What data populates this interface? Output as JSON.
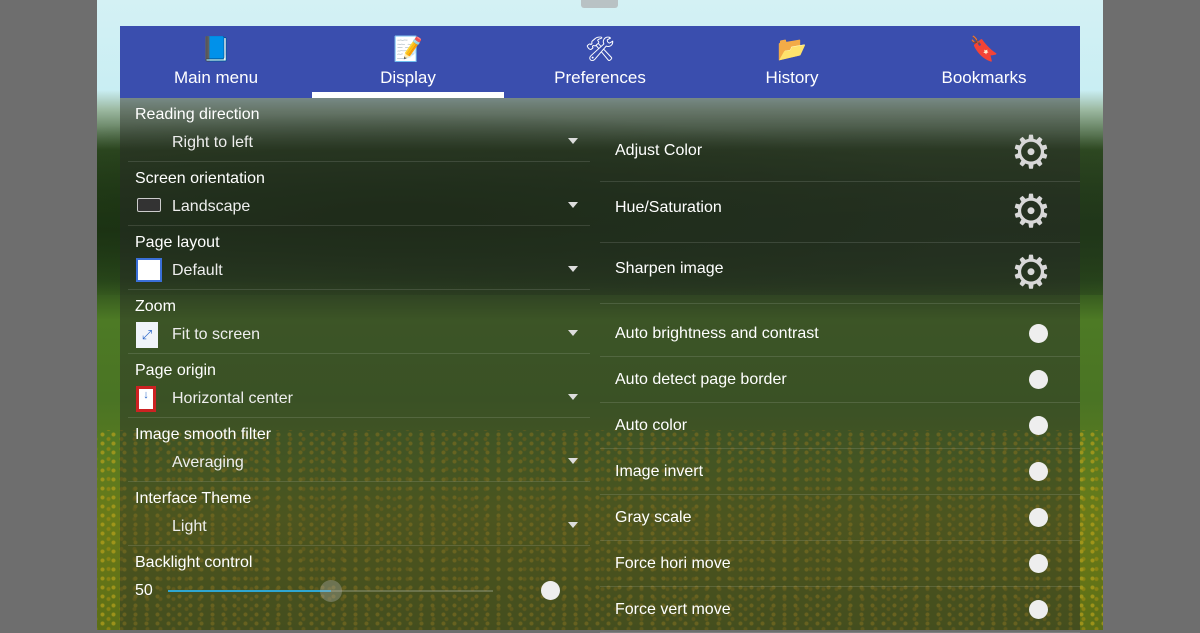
{
  "tabs": [
    {
      "label": "Main menu",
      "icon": "book-icon"
    },
    {
      "label": "Display",
      "icon": "display-settings-icon",
      "active": true
    },
    {
      "label": "Preferences",
      "icon": "tools-icon"
    },
    {
      "label": "History",
      "icon": "folder-clock-icon"
    },
    {
      "label": "Bookmarks",
      "icon": "bookmark-icon"
    }
  ],
  "left": [
    {
      "title": "Reading direction",
      "value": "Right to left"
    },
    {
      "title": "Screen orientation",
      "value": "Landscape",
      "icon": "landscape-icon"
    },
    {
      "title": "Page layout",
      "value": "Default",
      "icon": "page-layout-icon"
    },
    {
      "title": "Zoom",
      "value": "Fit to screen",
      "icon": "fit-screen-icon"
    },
    {
      "title": "Page origin",
      "value": "Horizontal center",
      "icon": "page-origin-icon"
    },
    {
      "title": "Image smooth filter",
      "value": "Averaging"
    },
    {
      "title": "Interface Theme",
      "value": "Light"
    }
  ],
  "backlight": {
    "title": "Backlight control",
    "value": "50",
    "slider_fraction": 0.5,
    "toggle": false
  },
  "right_gears": [
    {
      "label": "Adjust Color"
    },
    {
      "label": "Hue/Saturation"
    },
    {
      "label": "Sharpen image"
    }
  ],
  "right_toggles": [
    {
      "label": "Auto brightness and contrast",
      "on": false
    },
    {
      "label": "Auto detect page border",
      "on": false
    },
    {
      "label": "Auto color",
      "on": false
    },
    {
      "label": "Image invert",
      "on": false
    },
    {
      "label": "Gray scale",
      "on": false
    },
    {
      "label": "Force hori move",
      "on": false
    },
    {
      "label": "Force vert move",
      "on": false
    }
  ]
}
